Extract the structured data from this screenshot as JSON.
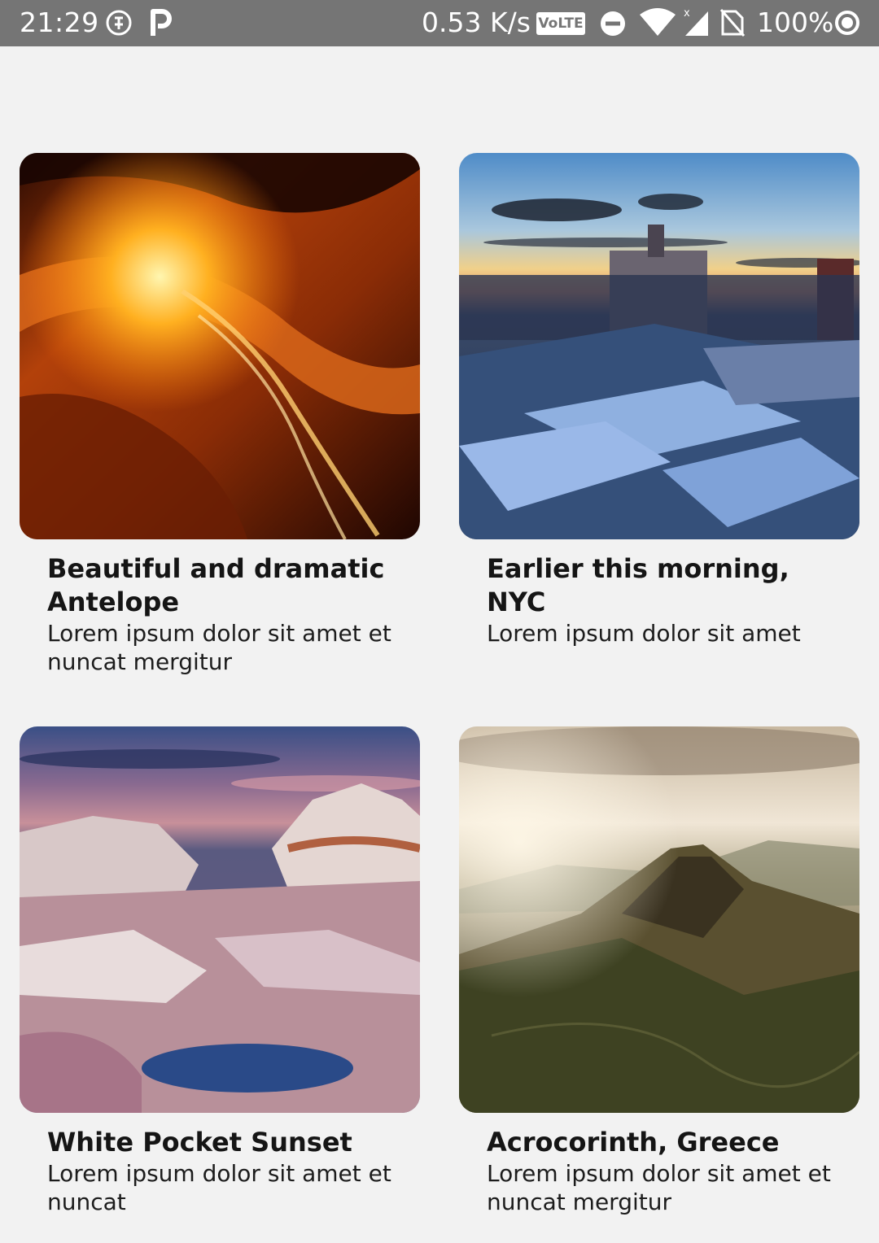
{
  "status_bar": {
    "time": "21:29",
    "net_speed": "0.53 K/s",
    "volte": "VoLTE",
    "battery": "100%"
  },
  "cards": [
    {
      "title": "Beautiful and dramatic Antelope",
      "description": "Lorem ipsum dolor sit amet et nuncat mergitur"
    },
    {
      "title": "Earlier this morning, NYC",
      "description": "Lorem ipsum dolor sit amet"
    },
    {
      "title": "White Pocket Sunset",
      "description": "Lorem ipsum dolor sit amet et nuncat"
    },
    {
      "title": "Acrocorinth, Greece",
      "description": "Lorem ipsum dolor sit amet et nuncat mergitur"
    }
  ]
}
